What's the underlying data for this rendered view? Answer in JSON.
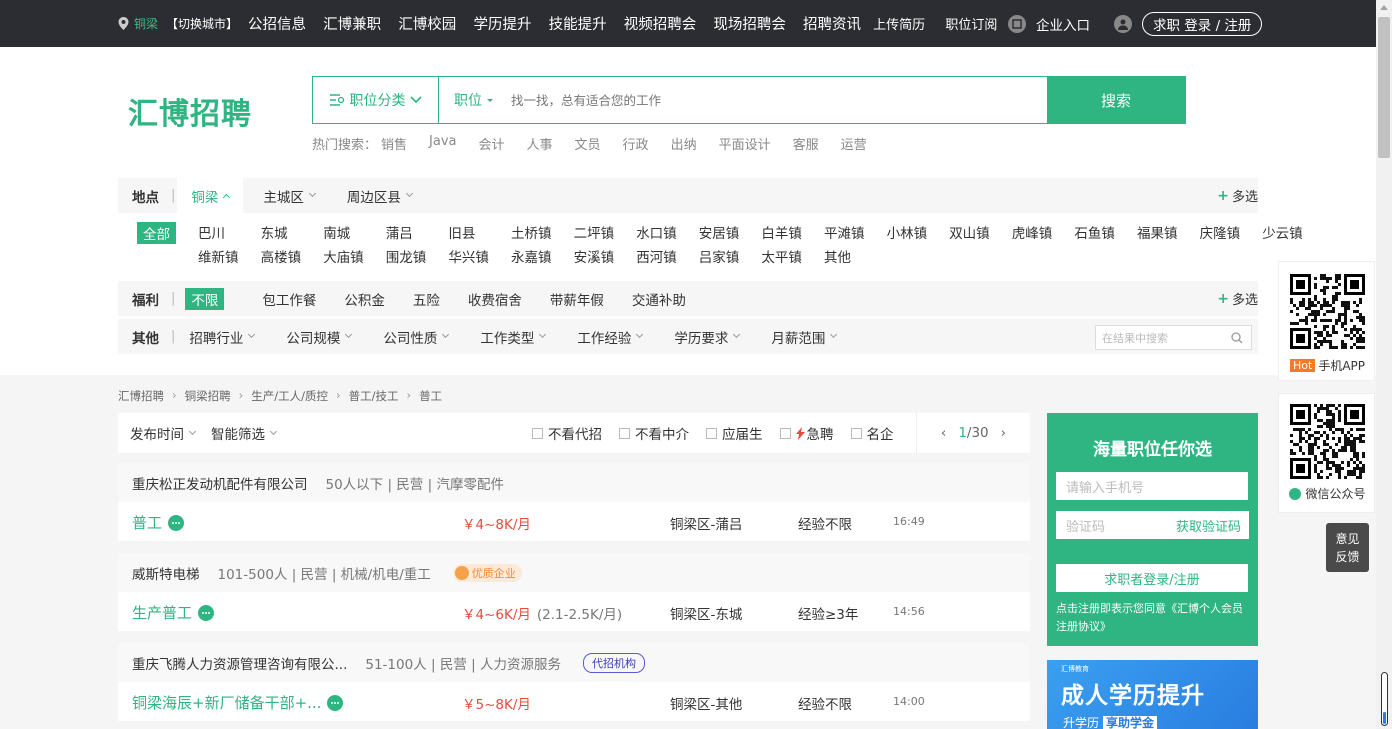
{
  "topbar": {
    "city": "铜梁",
    "switch_city": "【切换城市】",
    "nav": [
      "公招信息",
      "汇博兼职",
      "汇博校园",
      "学历提升",
      "技能提升",
      "视频招聘会",
      "现场招聘会",
      "招聘资讯"
    ],
    "nav_small": [
      "上传简历",
      "职位订阅"
    ],
    "enterprise": "企业入口",
    "login": "求职 登录 / 注册"
  },
  "logo": "汇博招聘",
  "search": {
    "category": "职位分类",
    "kind": "职位",
    "placeholder": "找一找，总有适合您的工作",
    "button": "搜索"
  },
  "hot_search": {
    "label": "热门搜索：",
    "items": [
      "销售",
      "Java",
      "会计",
      "人事",
      "文员",
      "行政",
      "出纳",
      "平面设计",
      "客服",
      "运营"
    ]
  },
  "filters": {
    "location_label": "地点",
    "location_tabs": [
      "铜梁",
      "主城区",
      "周边区县"
    ],
    "multi": "多选",
    "towns_row1": [
      "全部",
      "巴川",
      "东城",
      "南城",
      "蒲吕",
      "旧县",
      "土桥镇",
      "二坪镇",
      "水口镇",
      "安居镇",
      "白羊镇",
      "平滩镇",
      "小林镇",
      "双山镇",
      "虎峰镇",
      "石鱼镇",
      "福果镇",
      "庆隆镇",
      "少云镇"
    ],
    "towns_row2": [
      "维新镇",
      "高楼镇",
      "大庙镇",
      "围龙镇",
      "华兴镇",
      "永嘉镇",
      "安溪镇",
      "西河镇",
      "吕家镇",
      "太平镇",
      "其他"
    ],
    "welfare_label": "福利",
    "welfare": [
      "不限",
      "包工作餐",
      "公积金",
      "五险",
      "收费宿舍",
      "带薪年假",
      "交通补助"
    ],
    "other_label": "其他",
    "other": [
      "招聘行业",
      "公司规模",
      "公司性质",
      "工作类型",
      "工作经验",
      "学历要求",
      "月薪范围"
    ],
    "in_result_placeholder": "在结果中搜索"
  },
  "breadcrumb": [
    "汇博招聘",
    "铜梁招聘",
    "生产/工人/质控",
    "普工/技工",
    "普工"
  ],
  "sortbar": {
    "sorts": [
      "发布时间",
      "智能筛选"
    ],
    "checks": [
      "不看代招",
      "不看中介",
      "应届生",
      "急聘",
      "名企"
    ],
    "page_current": "1",
    "page_total": "/30"
  },
  "jobs": [
    {
      "company": "重庆松正发动机配件有限公司",
      "meta": "50人以下 | 民营 | 汽摩零配件",
      "badge": "",
      "title": "普工",
      "salary": "￥4~8K/月",
      "salary_sub": "",
      "area": "铜梁区-蒲吕",
      "exp": "经验不限",
      "time": "16:49"
    },
    {
      "company": "威斯特电梯",
      "meta": "101-500人 | 民营 | 机械/机电/重工",
      "badge": "优质企业",
      "title": "生产普工",
      "salary": "￥4~6K/月",
      "salary_sub": "(2.1-2.5K/月)",
      "area": "铜梁区-东城",
      "exp": "经验≥3年",
      "time": "14:56"
    },
    {
      "company": "重庆飞腾人力资源管理咨询有限公...",
      "meta": "51-100人 | 民营 | 人力资源服务",
      "badge": "代招机构",
      "title": "铜梁海辰+新厂储备干部+...",
      "salary": "￥5~8K/月",
      "salary_sub": "",
      "area": "铜梁区-其他",
      "exp": "经验不限",
      "time": "14:00"
    }
  ],
  "register": {
    "heading": "海量职位任你选",
    "phone_placeholder": "请输入手机号",
    "code_placeholder": "验证码",
    "get_code": "获取验证码",
    "button": "求职者登录/注册",
    "agreement": "点击注册即表示您同意《汇博个人会员注册协议》"
  },
  "ad": {
    "brand": "汇博教育",
    "title": "成人学历提升",
    "sub": "升学历",
    "sub_tag": "享助学金"
  },
  "side": {
    "app_hot": "Hot",
    "app_label": "手机APP",
    "wx_label": "微信公众号"
  },
  "feedback": [
    "意见",
    "反馈"
  ]
}
